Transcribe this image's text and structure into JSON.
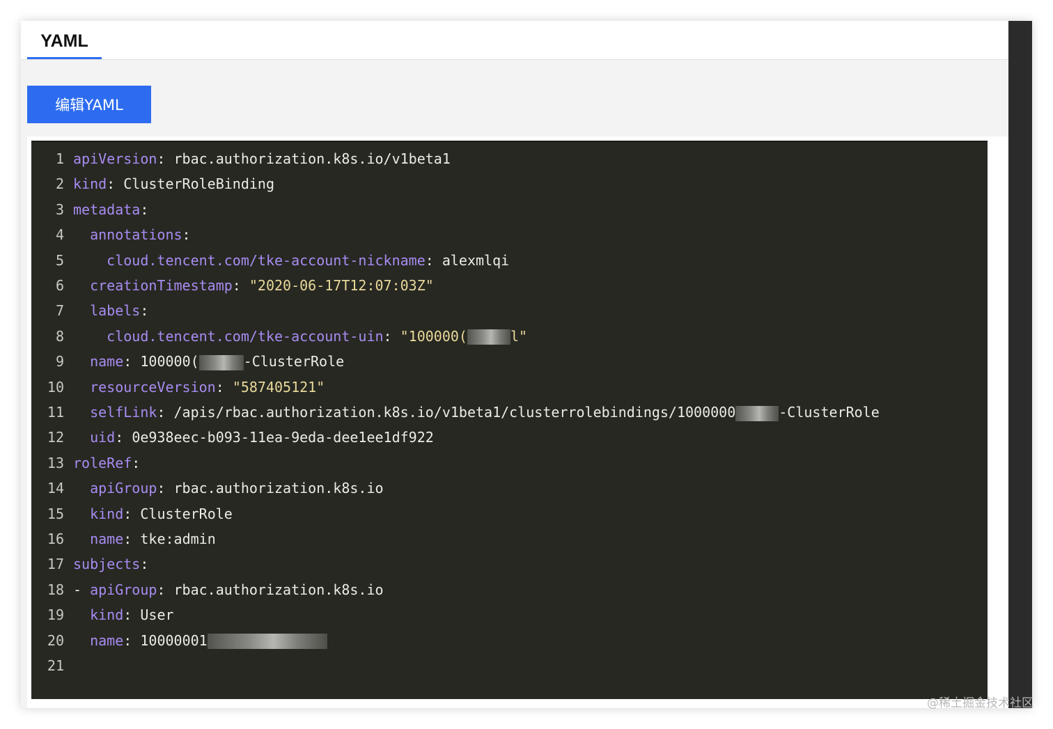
{
  "tabs": [
    {
      "label": "YAML",
      "active": true
    }
  ],
  "toolbar": {
    "edit_label": "编辑YAML"
  },
  "editor": {
    "lines": [
      {
        "n": "1",
        "indent": "",
        "key": "apiVersion",
        "value": "rbac.authorization.k8s.io/v1beta1"
      },
      {
        "n": "2",
        "indent": "",
        "key": "kind",
        "value": "ClusterRoleBinding"
      },
      {
        "n": "3",
        "indent": "",
        "key": "metadata",
        "value": ""
      },
      {
        "n": "4",
        "indent": "  ",
        "key": "annotations",
        "value": ""
      },
      {
        "n": "5",
        "indent": "    ",
        "key": "cloud.tencent.com/tke-account-nickname",
        "value": "alexmlqi"
      },
      {
        "n": "6",
        "indent": "  ",
        "key": "creationTimestamp",
        "value": "\"2020-06-17T12:07:03Z\"",
        "string": true
      },
      {
        "n": "7",
        "indent": "  ",
        "key": "labels",
        "value": ""
      },
      {
        "n": "8",
        "indent": "    ",
        "key": "cloud.tencent.com/tke-account-uin",
        "value": "\"100000(",
        "string": true,
        "redacted": true,
        "redact_width": 62,
        "suffix": "l\""
      },
      {
        "n": "9",
        "indent": "  ",
        "key": "name",
        "value": "100000(",
        "redacted": true,
        "redact_width": 64,
        "suffix": "-ClusterRole"
      },
      {
        "n": "10",
        "indent": "  ",
        "key": "resourceVersion",
        "value": "\"587405121\"",
        "string": true
      },
      {
        "n": "11",
        "indent": "  ",
        "key": "selfLink",
        "value": "/apis/rbac.authorization.k8s.io/v1beta1/clusterrolebindings/1000000",
        "redacted": true,
        "redact_width": 62,
        "suffix": "-ClusterRole"
      },
      {
        "n": "12",
        "indent": "  ",
        "key": "uid",
        "value": "0e938eec-b093-11ea-9eda-dee1ee1df922"
      },
      {
        "n": "13",
        "indent": "",
        "key": "roleRef",
        "value": ""
      },
      {
        "n": "14",
        "indent": "  ",
        "key": "apiGroup",
        "value": "rbac.authorization.k8s.io"
      },
      {
        "n": "15",
        "indent": "  ",
        "key": "kind",
        "value": "ClusterRole"
      },
      {
        "n": "16",
        "indent": "  ",
        "key": "name",
        "value": "tke:admin"
      },
      {
        "n": "17",
        "indent": "",
        "key": "subjects",
        "value": ""
      },
      {
        "n": "18",
        "indent": "- ",
        "key": "apiGroup",
        "value": "rbac.authorization.k8s.io"
      },
      {
        "n": "19",
        "indent": "  ",
        "key": "kind",
        "value": "User"
      },
      {
        "n": "20",
        "indent": "  ",
        "key": "name",
        "value": "10000001",
        "redacted": true,
        "redact_width": 172,
        "suffix": ""
      },
      {
        "n": "21",
        "indent": "",
        "key": "",
        "value": ""
      }
    ]
  },
  "colors": {
    "accent": "#2d6cf0",
    "editor_bg": "#272822",
    "key": "#a88cf2",
    "string": "#e8d99a"
  },
  "watermark": "@稀土掘金技术社区"
}
